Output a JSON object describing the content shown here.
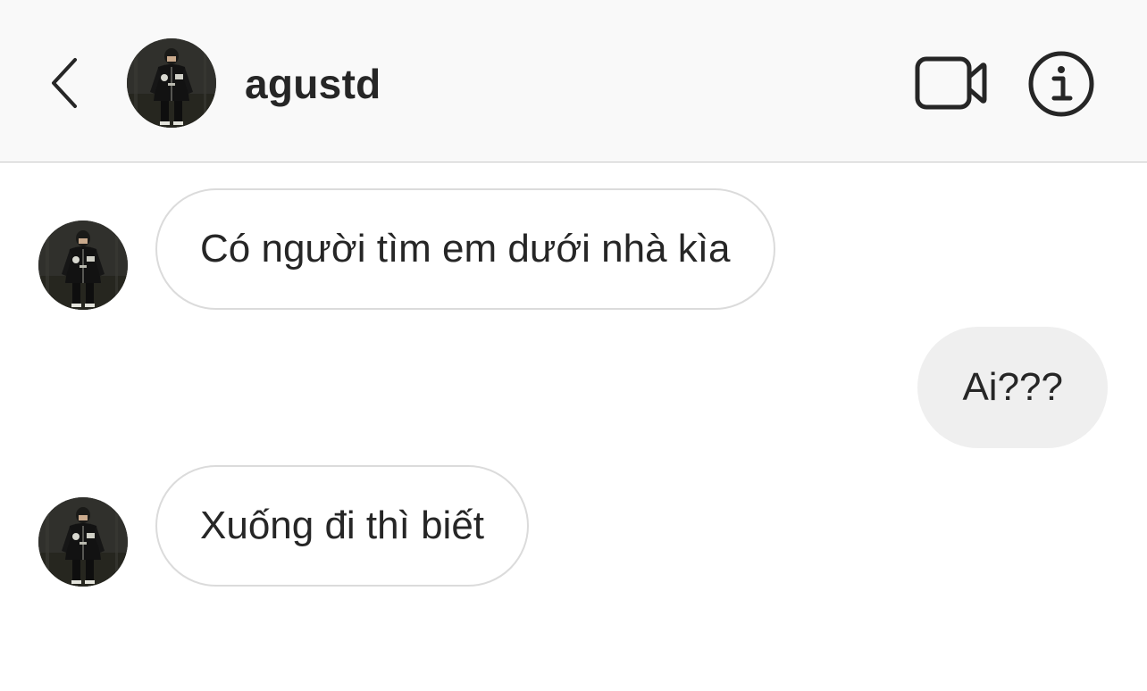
{
  "header": {
    "username": "agustd",
    "back_icon": "chevron-left-icon",
    "video_icon": "video-camera-icon",
    "info_icon": "info-circle-icon"
  },
  "messages": [
    {
      "direction": "received",
      "text": "Có người tìm em dưới nhà kìa"
    },
    {
      "direction": "sent",
      "text": "Ai???"
    },
    {
      "direction": "received",
      "text": "Xuống đi thì biết"
    }
  ],
  "colors": {
    "header_bg": "#f9f9f9",
    "text": "#262626",
    "received_border": "#dbdbdb",
    "sent_bg": "#efefef"
  }
}
